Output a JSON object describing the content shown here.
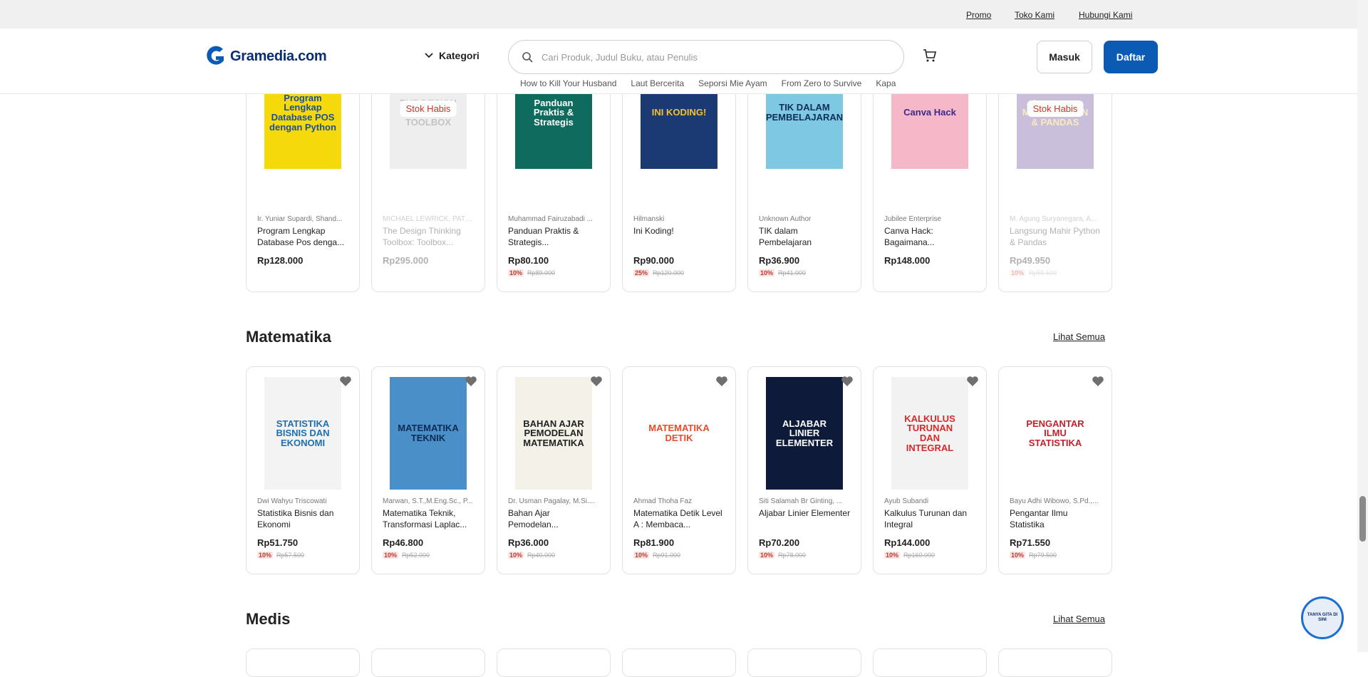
{
  "topbar": {
    "links": [
      "Promo",
      "Toko Kami",
      "Hubungi Kami"
    ]
  },
  "header": {
    "brand": "Gramedia.com",
    "kategori": "Kategori",
    "search_placeholder": "Cari Produk, Judul Buku, atau Penulis",
    "login": "Masuk",
    "register": "Daftar",
    "suggestions": [
      "How to Kill Your Husband",
      "Laut Bercerita",
      "Seporsi Mie Ayam",
      "From Zero to Survive",
      "Kapa"
    ]
  },
  "row1": [
    {
      "author": "Ir. Yuniar Supardi, Shand...",
      "title": "Program Lengkap Database Pos denga...",
      "price": "Rp128.000",
      "disc": "",
      "orig": "",
      "stok": "",
      "cover_text": "Program Lengkap Database POS dengan Python",
      "bg": "#f5d90a",
      "fg": "#1a4fa0"
    },
    {
      "author": "MICHAEL LEWRICK, PATR...",
      "title": "The Design Thinking Toolbox: Toolbox...",
      "price": "Rp295.000",
      "disc": "",
      "orig": "",
      "stok": "Stok Habis",
      "cover_text": "THE DESIGN THINKING TOOLBOX",
      "bg": "#cfcfcf",
      "fg": "#555555"
    },
    {
      "author": "Muhammad Fairuzabadi ...",
      "title": "Panduan Praktis & Strategis...",
      "price": "Rp80.100",
      "disc": "10%",
      "orig": "Rp89.000",
      "stok": "",
      "cover_text": "Panduan Praktis & Strategis",
      "bg": "#0e6b5e",
      "fg": "#ffffff"
    },
    {
      "author": "Hilmanski",
      "title": "Ini Koding!",
      "price": "Rp90.000",
      "disc": "25%",
      "orig": "Rp120.000",
      "stok": "",
      "cover_text": "INI KODING!",
      "bg": "#1b3a73",
      "fg": "#f2c230"
    },
    {
      "author": "Unknown Author",
      "title": "TIK dalam Pembelajaran",
      "price": "Rp36.900",
      "disc": "10%",
      "orig": "Rp41.000",
      "stok": "",
      "cover_text": "TIK DALAM PEMBELAJARAN",
      "bg": "#7ec8e3",
      "fg": "#0d2f5a"
    },
    {
      "author": "Jubilee Enterprise",
      "title": "Canva Hack: Bagaimana...",
      "price": "Rp148.000",
      "disc": "",
      "orig": "",
      "stok": "",
      "cover_text": "Canva Hack",
      "bg": "#f6b8c8",
      "fg": "#3a2a8a"
    },
    {
      "author": "M. Agung Suryanegara, A...",
      "title": "Langsung Mahir Python & Pandas",
      "price": "Rp49.950",
      "disc": "10%",
      "orig": "Rp55.500",
      "stok": "Stok Habis",
      "cover_text": "Langsung Mahir PYTHON & PANDAS",
      "bg": "#6b4a9a",
      "fg": "#f5c842"
    }
  ],
  "matematika": {
    "title": "Matematika",
    "see_all": "Lihat Semua",
    "items": [
      {
        "author": "Dwi Wahyu Triscowati",
        "title": "Statistika Bisnis dan Ekonomi",
        "price": "Rp51.750",
        "disc": "10%",
        "orig": "Rp57.500",
        "cover_text": "STATISTIKA BISNIS DAN EKONOMI",
        "bg": "#f3f3f3",
        "fg": "#1d6fb0"
      },
      {
        "author": "Marwan, S.T.,M.Eng.Sc., P...",
        "title": "Matematika Teknik, Transformasi Laplac...",
        "price": "Rp46.800",
        "disc": "10%",
        "orig": "Rp52.000",
        "cover_text": "MATEMATIKA TEKNIK",
        "bg": "#4a8fc8",
        "fg": "#0c2a55"
      },
      {
        "author": "Dr. Usman Pagalay, M.Si....",
        "title": "Bahan Ajar Pemodelan...",
        "price": "Rp36.000",
        "disc": "10%",
        "orig": "Rp40.000",
        "cover_text": "BAHAN AJAR PEMODELAN MATEMATIKA",
        "bg": "#f4f1e8",
        "fg": "#222222"
      },
      {
        "author": "Ahmad Thoha Faz",
        "title": "Matematika Detik Level A : Membaca...",
        "price": "Rp81.900",
        "disc": "10%",
        "orig": "Rp91.000",
        "cover_text": "MATEMATIKA DETIK",
        "bg": "#ffffff",
        "fg": "#e84a2a"
      },
      {
        "author": "Siti Salamah Br Ginting, ...",
        "title": "Aljabar Linier Elementer",
        "price": "Rp70.200",
        "disc": "10%",
        "orig": "Rp78.000",
        "cover_text": "ALJABAR LINIER ELEMENTER",
        "bg": "#0d1a3a",
        "fg": "#ffffff"
      },
      {
        "author": "Ayub Subandi",
        "title": "Kalkulus Turunan dan Integral",
        "price": "Rp144.000",
        "disc": "10%",
        "orig": "Rp160.000",
        "cover_text": "KALKULUS TURUNAN DAN INTEGRAL",
        "bg": "#f2f2f2",
        "fg": "#d42a2a"
      },
      {
        "author": "Bayu Adhi Wibowo, S.Pd.,...",
        "title": "Pengantar Ilmu Statistika",
        "price": "Rp71.550",
        "disc": "10%",
        "orig": "Rp79.500",
        "cover_text": "PENGANTAR ILMU STATISTIKA",
        "bg": "#ffffff",
        "fg": "#c0222a"
      }
    ]
  },
  "medis": {
    "title": "Medis",
    "see_all": "Lihat Semua"
  },
  "chat": {
    "label": "TANYA GITA DI SINI"
  },
  "colors": {
    "brand": "#0b5bb5",
    "discount": "#c0392b"
  }
}
